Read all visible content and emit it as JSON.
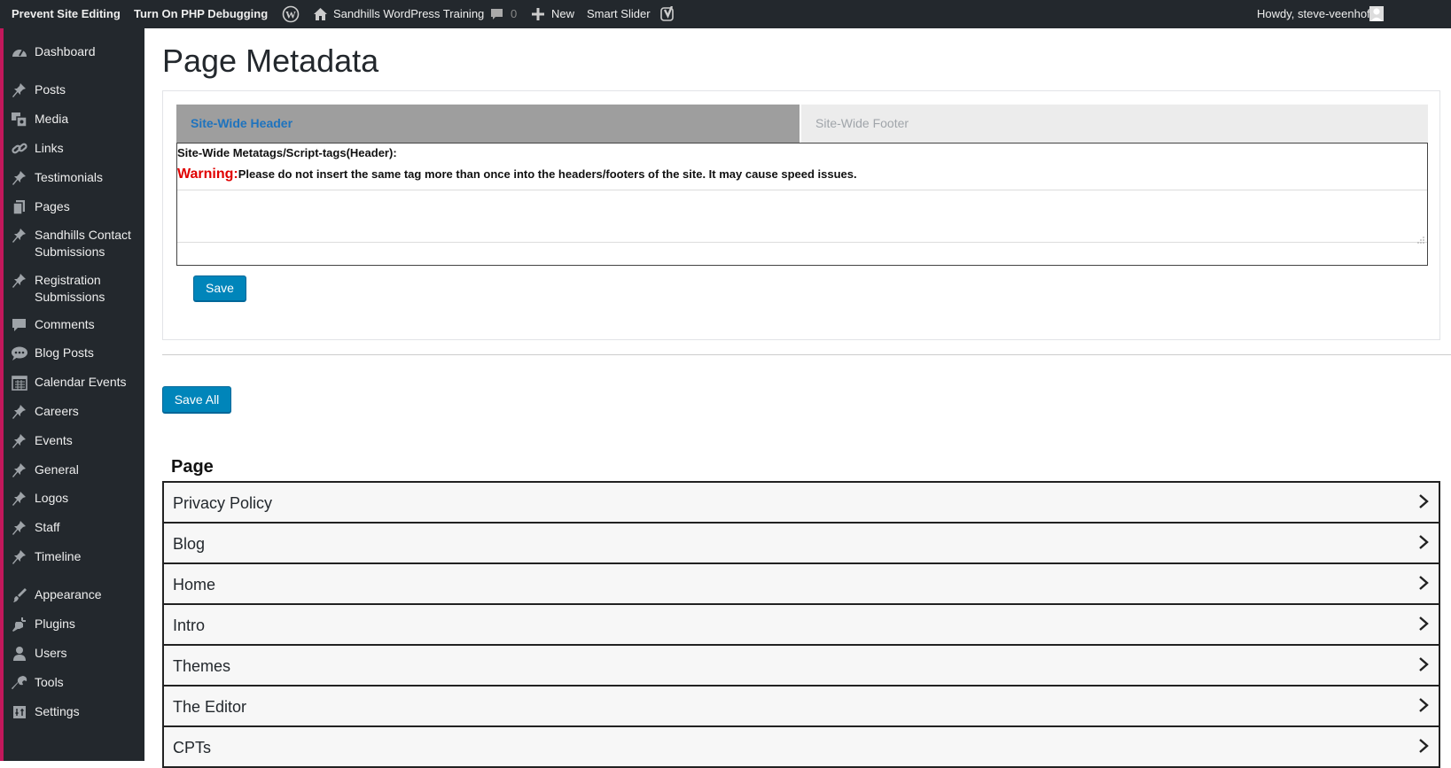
{
  "adminbar": {
    "prevent_editing": "Prevent Site Editing",
    "php_debugging": "Turn On PHP Debugging",
    "site_name": "Sandhills WordPress Training",
    "comments_count": "0",
    "new_label": "New",
    "smart_slider": "Smart Slider",
    "howdy": "Howdy, steve-veenhof"
  },
  "sidebar": {
    "accent_color": "#c2185b",
    "items": [
      {
        "label": "Dashboard",
        "icon": "dashboard-icon"
      },
      {
        "label": "Posts",
        "icon": "pin-icon"
      },
      {
        "label": "Media",
        "icon": "media-icon"
      },
      {
        "label": "Links",
        "icon": "link-icon"
      },
      {
        "label": "Testimonials",
        "icon": "pin-icon"
      },
      {
        "label": "Pages",
        "icon": "pages-icon"
      },
      {
        "label": "Sandhills Contact Submissions",
        "icon": "pin-icon"
      },
      {
        "label": "Registration Submissions",
        "icon": "pin-icon"
      },
      {
        "label": "Comments",
        "icon": "comment-icon"
      },
      {
        "label": "Blog Posts",
        "icon": "speech-icon"
      },
      {
        "label": "Calendar Events",
        "icon": "calendar-icon"
      },
      {
        "label": "Careers",
        "icon": "pin-icon"
      },
      {
        "label": "Events",
        "icon": "pin-icon"
      },
      {
        "label": "General",
        "icon": "pin-icon"
      },
      {
        "label": "Logos",
        "icon": "pin-icon"
      },
      {
        "label": "Staff",
        "icon": "pin-icon"
      },
      {
        "label": "Timeline",
        "icon": "pin-icon"
      },
      {
        "label": "Appearance",
        "icon": "brush-icon"
      },
      {
        "label": "Plugins",
        "icon": "plugin-icon"
      },
      {
        "label": "Users",
        "icon": "user-icon"
      },
      {
        "label": "Tools",
        "icon": "wrench-icon"
      },
      {
        "label": "Settings",
        "icon": "settings-icon"
      }
    ]
  },
  "main": {
    "title": "Page Metadata",
    "tabs": [
      {
        "label": "Site-Wide Header",
        "active": true
      },
      {
        "label": "Site-Wide Footer",
        "active": false
      }
    ],
    "field_label": "Site-Wide Metatags/Script-tags(Header):",
    "warning_label": "Warning:",
    "warning_text": "Please do not insert the same tag more than once into the headers/footers of the site. It may cause speed issues.",
    "textarea_value": "",
    "save_label": "Save",
    "save_all_label": "Save All",
    "page_heading": "Page",
    "pages": [
      "Privacy Policy",
      "Blog",
      "Home",
      "Intro",
      "Themes",
      "The Editor",
      "CPTs"
    ]
  }
}
